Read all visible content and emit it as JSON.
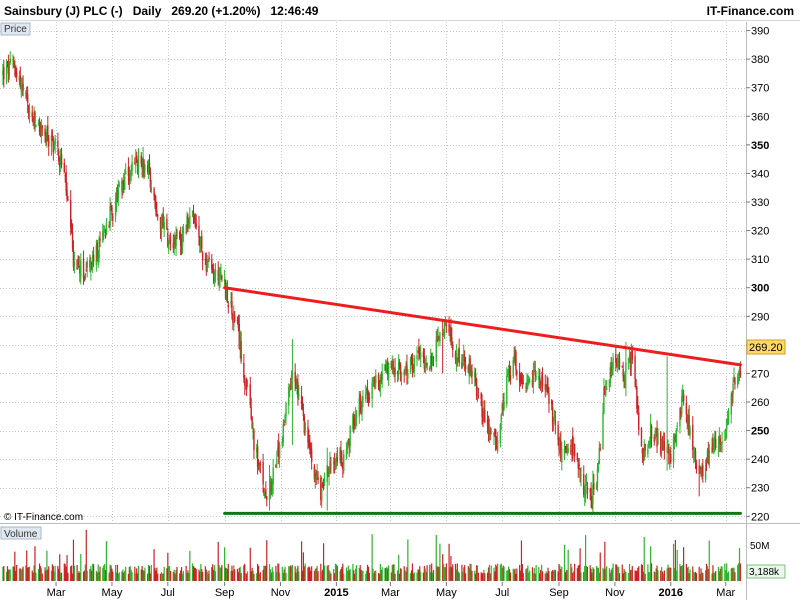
{
  "header": {
    "instrument": "Sainsbury (J) PLC (-)",
    "period": "Daily",
    "last": "269.20 (+1.20%)",
    "time": "12:46:49",
    "site": "IT-Finance.com"
  },
  "watermark": "© IT-Finance.com",
  "price_panel_label": "Price",
  "volume_panel_label": "Volume",
  "colors": {
    "up": "#2db52d",
    "down": "#cc2222",
    "resistance": "#ee1c1c",
    "support": "#117711",
    "grid": "#c8c8c8",
    "panel_label_bg": "#dfe8f0",
    "last_price_bg": "#ffd966"
  },
  "chart_data": {
    "type": "candlestick",
    "price_axis": {
      "ylim": [
        218,
        393
      ],
      "ticks": [
        220,
        230,
        240,
        250,
        260,
        270,
        280,
        290,
        300,
        310,
        320,
        330,
        340,
        350,
        360,
        370,
        380,
        390
      ],
      "bold_ticks": [
        250,
        300,
        350
      ],
      "last_price_label": "269.20",
      "last_price": 269.2
    },
    "volume_axis": {
      "ticks_text": [
        "50M"
      ],
      "current_volume_label": "3,188k"
    },
    "x_axis": {
      "ticks": [
        {
          "label": "Mar",
          "date": "2014-03-01"
        },
        {
          "label": "May",
          "date": "2014-05-01"
        },
        {
          "label": "Jul",
          "date": "2014-07-01"
        },
        {
          "label": "Sep",
          "date": "2014-09-01"
        },
        {
          "label": "Nov",
          "date": "2014-11-01"
        },
        {
          "label": "2015",
          "date": "2015-01-01",
          "bold": true
        },
        {
          "label": "Mar",
          "date": "2015-03-01"
        },
        {
          "label": "May",
          "date": "2015-05-01"
        },
        {
          "label": "Jul",
          "date": "2015-07-01"
        },
        {
          "label": "Sep",
          "date": "2015-09-01"
        },
        {
          "label": "Nov",
          "date": "2015-11-01"
        },
        {
          "label": "2016",
          "date": "2016-01-01",
          "bold": true
        },
        {
          "label": "Mar",
          "date": "2016-03-01"
        }
      ]
    },
    "trendlines": [
      {
        "name": "resistance",
        "from": {
          "date": "2014-09-01",
          "price": 300
        },
        "to": {
          "date": "2016-03-17",
          "price": 273
        }
      },
      {
        "name": "support",
        "from": {
          "date": "2014-09-01",
          "price": 221
        },
        "to": {
          "date": "2016-03-17",
          "price": 221
        }
      }
    ],
    "close_path": [
      [
        "2014-01-02",
        375
      ],
      [
        "2014-01-15",
        378
      ],
      [
        "2014-02-01",
        360
      ],
      [
        "2014-02-20",
        352
      ],
      [
        "2014-03-01",
        350
      ],
      [
        "2014-03-10",
        340
      ],
      [
        "2014-03-20",
        310
      ],
      [
        "2014-04-01",
        305
      ],
      [
        "2014-04-15",
        312
      ],
      [
        "2014-04-25",
        322
      ],
      [
        "2014-05-05",
        330
      ],
      [
        "2014-05-20",
        340
      ],
      [
        "2014-06-01",
        345
      ],
      [
        "2014-06-10",
        342
      ],
      [
        "2014-06-20",
        325
      ],
      [
        "2014-07-01",
        318
      ],
      [
        "2014-07-15",
        316
      ],
      [
        "2014-07-25",
        325
      ],
      [
        "2014-08-01",
        320
      ],
      [
        "2014-08-10",
        310
      ],
      [
        "2014-08-20",
        304
      ],
      [
        "2014-08-28",
        306
      ],
      [
        "2014-09-05",
        295
      ],
      [
        "2014-09-15",
        285
      ],
      [
        "2014-09-25",
        265
      ],
      [
        "2014-10-05",
        242
      ],
      [
        "2014-10-15",
        228
      ],
      [
        "2014-10-22",
        232
      ],
      [
        "2014-11-01",
        245
      ],
      [
        "2014-11-10",
        262
      ],
      [
        "2014-11-15",
        270
      ],
      [
        "2014-11-25",
        255
      ],
      [
        "2014-12-05",
        240
      ],
      [
        "2014-12-15",
        228
      ],
      [
        "2014-12-20",
        235
      ],
      [
        "2015-01-01",
        243
      ],
      [
        "2015-01-10",
        238
      ],
      [
        "2015-01-20",
        255
      ],
      [
        "2015-02-01",
        262
      ],
      [
        "2015-02-15",
        268
      ],
      [
        "2015-03-01",
        272
      ],
      [
        "2015-03-15",
        270
      ],
      [
        "2015-04-01",
        276
      ],
      [
        "2015-04-15",
        274
      ],
      [
        "2015-04-28",
        286
      ],
      [
        "2015-05-15",
        276
      ],
      [
        "2015-06-01",
        268
      ],
      [
        "2015-06-15",
        250
      ],
      [
        "2015-06-25",
        246
      ],
      [
        "2015-07-05",
        265
      ],
      [
        "2015-07-15",
        274
      ],
      [
        "2015-07-25",
        262
      ],
      [
        "2015-08-05",
        270
      ],
      [
        "2015-08-15",
        266
      ],
      [
        "2015-08-25",
        255
      ],
      [
        "2015-09-05",
        240
      ],
      [
        "2015-09-15",
        244
      ],
      [
        "2015-09-25",
        232
      ],
      [
        "2015-10-05",
        226
      ],
      [
        "2015-10-12",
        230
      ],
      [
        "2015-10-20",
        262
      ],
      [
        "2015-11-01",
        275
      ],
      [
        "2015-11-10",
        270
      ],
      [
        "2015-11-20",
        276
      ],
      [
        "2015-12-01",
        240
      ],
      [
        "2015-12-10",
        250
      ],
      [
        "2015-12-20",
        245
      ],
      [
        "2016-01-01",
        240
      ],
      [
        "2016-01-15",
        262
      ],
      [
        "2016-01-25",
        245
      ],
      [
        "2016-02-01",
        232
      ],
      [
        "2016-02-10",
        240
      ],
      [
        "2016-02-20",
        246
      ],
      [
        "2016-03-01",
        250
      ],
      [
        "2016-03-10",
        266
      ],
      [
        "2016-03-17",
        269.2
      ]
    ],
    "spikes": [
      {
        "date": "2014-11-14",
        "high": 282,
        "low": 245
      },
      {
        "date": "2015-04-27",
        "high": 289,
        "low": 270
      },
      {
        "date": "2015-11-13",
        "high": 281,
        "low": 262
      },
      {
        "date": "2015-12-28",
        "high": 276,
        "low": 236
      },
      {
        "date": "2014-10-20",
        "high": 238,
        "low": 222
      },
      {
        "date": "2014-12-22",
        "high": 244,
        "low": 222
      },
      {
        "date": "2015-10-08",
        "high": 236,
        "low": 221
      },
      {
        "date": "2016-02-01",
        "high": 240,
        "low": 227
      }
    ]
  }
}
